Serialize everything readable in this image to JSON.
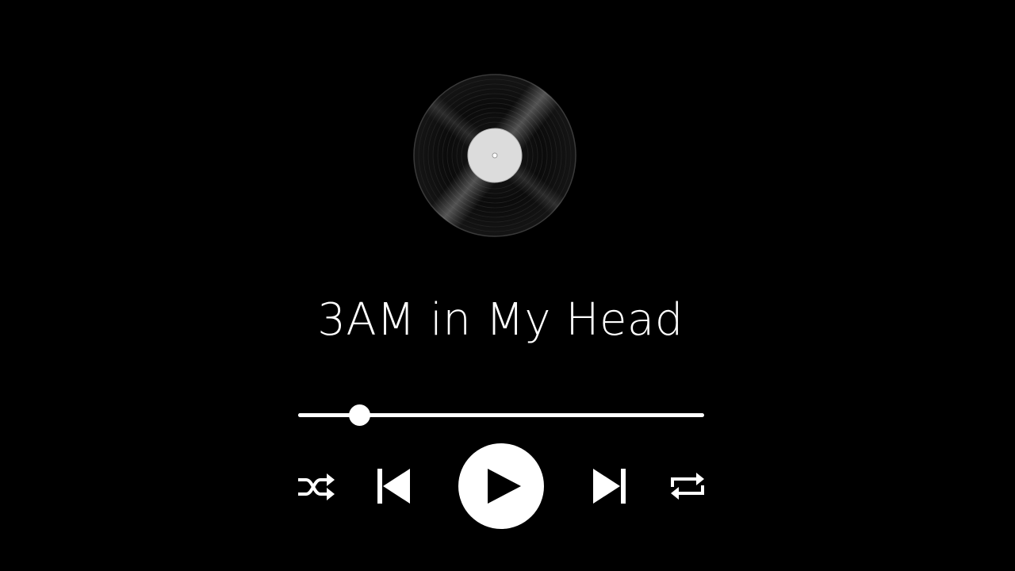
{
  "player": {
    "track_title": "3AM in My Head",
    "progress_fraction": 0.15,
    "shuffle_label": "shuffle",
    "previous_label": "previous",
    "play_label": "play",
    "next_label": "next",
    "repeat_label": "repeat"
  },
  "icons": {
    "artwork": "vinyl-record-icon",
    "shuffle": "shuffle-icon",
    "previous": "skip-previous-icon",
    "play": "play-icon",
    "next": "skip-next-icon",
    "repeat": "repeat-icon"
  },
  "colors": {
    "background": "#000000",
    "foreground": "#ffffff",
    "vinyl": "#0c0c0c",
    "label": "#d8d8d8"
  }
}
